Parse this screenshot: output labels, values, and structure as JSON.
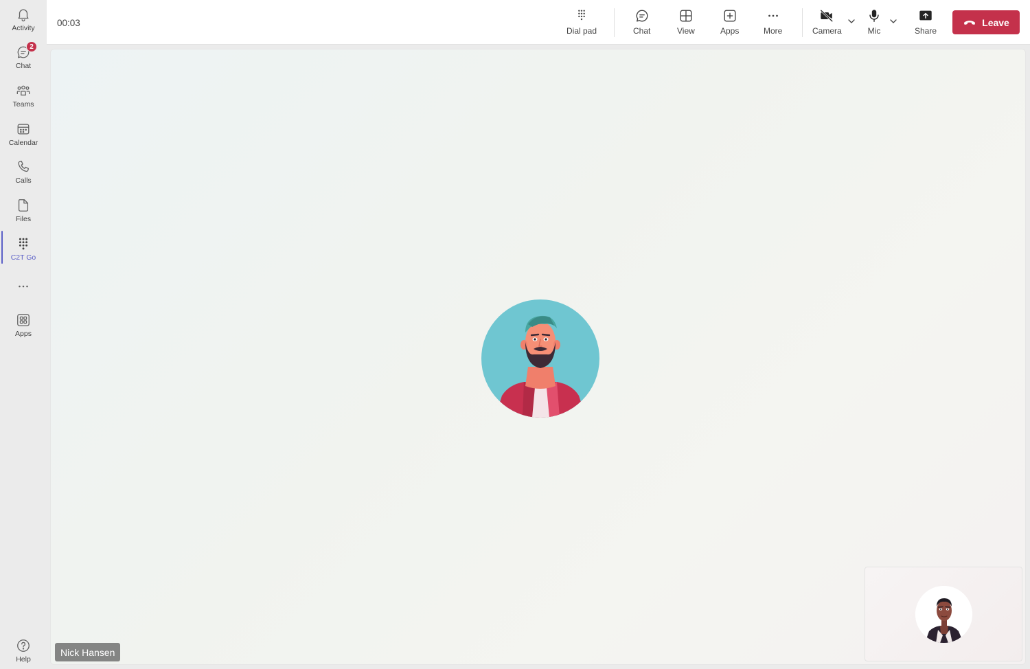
{
  "rail": {
    "items": [
      {
        "label": "Activity",
        "icon": "bell-icon"
      },
      {
        "label": "Chat",
        "icon": "chat-icon",
        "badge": "2"
      },
      {
        "label": "Teams",
        "icon": "teams-icon"
      },
      {
        "label": "Calendar",
        "icon": "calendar-icon"
      },
      {
        "label": "Calls",
        "icon": "phone-icon"
      },
      {
        "label": "Files",
        "icon": "file-icon"
      },
      {
        "label": "C2T Go",
        "icon": "dialpad-icon",
        "active": true
      },
      {
        "label": "",
        "icon": "more-icon"
      },
      {
        "label": "Apps",
        "icon": "apps-icon"
      }
    ],
    "help_label": "Help"
  },
  "call": {
    "timer": "00:03",
    "toolbar": {
      "dialpad_label": "Dial pad",
      "chat_label": "Chat",
      "view_label": "View",
      "apps_label": "Apps",
      "more_label": "More",
      "camera_label": "Camera",
      "mic_label": "Mic",
      "share_label": "Share",
      "leave_label": "Leave"
    },
    "participant_name": "Nick Hansen"
  },
  "colors": {
    "accent": "#5b5fc7",
    "leave": "#c4314b",
    "badge": "#c4314b",
    "avatar_bg": "#6fc6d1"
  }
}
